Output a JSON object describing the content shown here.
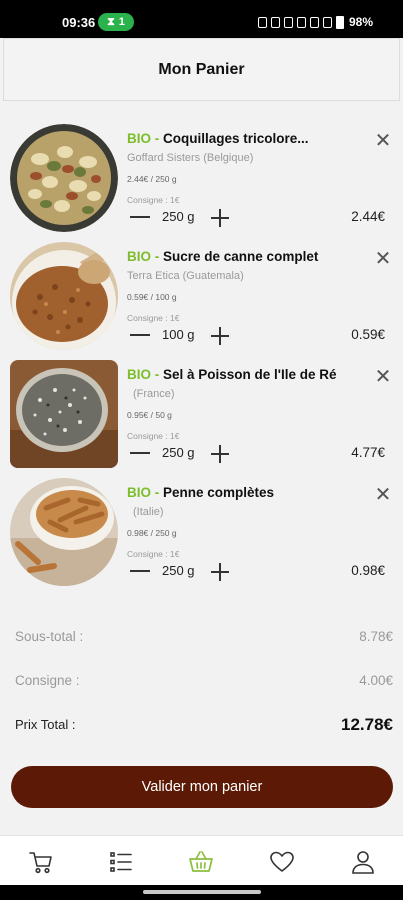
{
  "status_bar": {
    "time": "09:36",
    "pill": "1",
    "battery": "98%"
  },
  "header": {
    "title": "Mon Panier"
  },
  "items": [
    {
      "bio": "BIO -",
      "name": "Coquillages tricolore...",
      "origin": "Goffard Sisters (Belgique)",
      "unit_price": "2.44€ / 250 g",
      "consigne": "Consigne : 1€",
      "quantity": "250 g",
      "price": "2.44€"
    },
    {
      "bio": "BIO -",
      "name": "Sucre de canne complet",
      "origin": "Terra Etica (Guatemala)",
      "unit_price": "0.59€ / 100 g",
      "consigne": "Consigne : 1€",
      "quantity": "100 g",
      "price": "0.59€"
    },
    {
      "bio": "BIO -",
      "name": "Sel à Poisson de l'Ile de Ré",
      "origin": "(France)",
      "unit_price": "0.95€ / 50 g",
      "consigne": "Consigne : 1€",
      "quantity": "250 g",
      "price": "4.77€"
    },
    {
      "bio": "BIO -",
      "name": "Penne complètes",
      "origin": "(Italie)",
      "unit_price": "0.98€ / 250 g",
      "consigne": "Consigne : 1€",
      "quantity": "250 g",
      "price": "0.98€"
    }
  ],
  "totals": {
    "subtotal_label": "Sous-total :",
    "subtotal": "8.78€",
    "consigne_label": "Consigne :",
    "consigne": "4.00€",
    "total_label": "Prix Total :",
    "total": "12.78€"
  },
  "cta": {
    "label": "Valider mon panier"
  },
  "nav": [
    "cart-icon",
    "list-icon",
    "basket-icon",
    "heart-icon",
    "user-icon"
  ],
  "colors": {
    "bio_green": "#7cbd2a",
    "button_brown": "#5c1a06",
    "nav_active": "#8bbf3f"
  }
}
